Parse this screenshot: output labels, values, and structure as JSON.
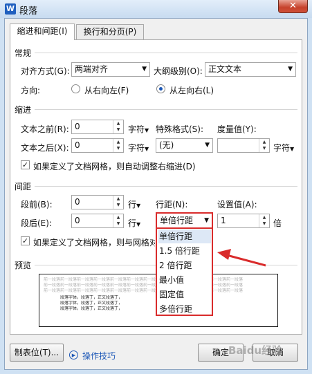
{
  "window": {
    "title": "段落",
    "app_icon": "W",
    "close": "✕"
  },
  "tabs": [
    {
      "label": "缩进和间距(I)",
      "active": true
    },
    {
      "label": "换行和分页(P)",
      "active": false
    }
  ],
  "general": {
    "title": "常规",
    "alignment_label": "对齐方式(G):",
    "alignment_value": "两端对齐",
    "outline_label": "大纲级别(O):",
    "outline_value": "正文文本",
    "direction_label": "方向:",
    "rtl_label": "从右向左(F)",
    "ltr_label": "从左向右(L)"
  },
  "indent": {
    "title": "缩进",
    "before_label": "文本之前(R):",
    "before_value": "0",
    "before_unit": "字符",
    "after_label": "文本之后(X):",
    "after_value": "0",
    "after_unit": "字符",
    "special_label": "特殊格式(S):",
    "special_value": "(无)",
    "measure_label": "度量值(Y):",
    "measure_value": "",
    "measure_unit": "字符",
    "auto_adjust_label": "如果定义了文档网格，则自动调整右缩进(D)",
    "auto_adjust_checked": true
  },
  "spacing": {
    "title": "间距",
    "before_label": "段前(B):",
    "before_value": "0",
    "before_unit": "行",
    "after_label": "段后(E):",
    "after_value": "0",
    "after_unit": "行",
    "line_spacing_label": "行距(N):",
    "line_spacing_value": "单倍行距",
    "set_value_label": "设置值(A):",
    "set_value": "1",
    "set_value_unit": "倍",
    "grid_align_label": "如果定义了文档网格，则与网格对",
    "grid_align_checked": true,
    "line_spacing_options": [
      "单倍行距",
      "1.5 倍行距",
      "2 倍行距",
      "最小值",
      "固定值",
      "多倍行距"
    ],
    "selected_option_index": 0
  },
  "preview": {
    "title": "预览",
    "sample_before": "前一段落前一段落前一段落前一段落前一段落前一段落前一段落前一段落前一段落前一段落前一段落前一段落",
    "sample_body": [
      "段落字体，段落丁，正文段落丁，",
      "段落字体，段落丁，正文段落丁，",
      "段落字体，段落丁，正文段落丁，"
    ]
  },
  "footer": {
    "tabs_button": "制表位(T)...",
    "tips_link": "操作技巧",
    "ok_button": "确定",
    "cancel_button": "取消"
  },
  "watermark": "Baidu经验",
  "colors": {
    "highlight": "#d92b2b",
    "link": "#1d58b7"
  }
}
